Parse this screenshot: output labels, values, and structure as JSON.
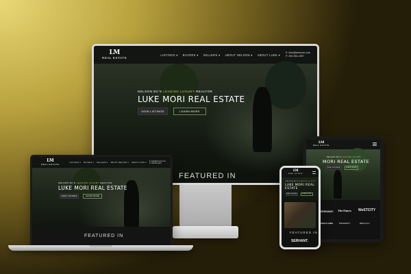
{
  "site": {
    "logo_mark": "LM",
    "logo_sub": "REAL ESTATE",
    "nav": [
      "LISTINGS ▾",
      "BUYERS ▾",
      "SELLERS ▾",
      "ABOUT NELSON ▾",
      "ABOUT LUKE ▾"
    ],
    "contact_email": "E: luke@lukemori.com",
    "contact_phone": "P: 250-551-4097",
    "tagline_prefix": "NELSON BC'S",
    "tagline_gold": "LEADING LUXURY",
    "tagline_suffix": "REALTOR",
    "hero_title": "LUKE MORI REAL ESTATE",
    "btn_listings": "VIEW LISTINGS",
    "btn_learn": "LEARN MORE",
    "featured": "FEATURED IN",
    "featured_partial": "FEATURED IN"
  },
  "tablet": {
    "title": "MORI REAL ESTATE",
    "brands": [
      "SERHANT.",
      "TheTimes",
      "WeSTCITY",
      "URBLFLAIRS",
      "PROPERTY",
      "BRSerTom"
    ]
  },
  "phone": {
    "title": "LUKE MORI REAL ESTATE",
    "brand": "SERHANT."
  },
  "colors": {
    "accent_gold": "#d8c06a",
    "button_outline": "#6d8a57",
    "nav_bg": "#121512"
  }
}
